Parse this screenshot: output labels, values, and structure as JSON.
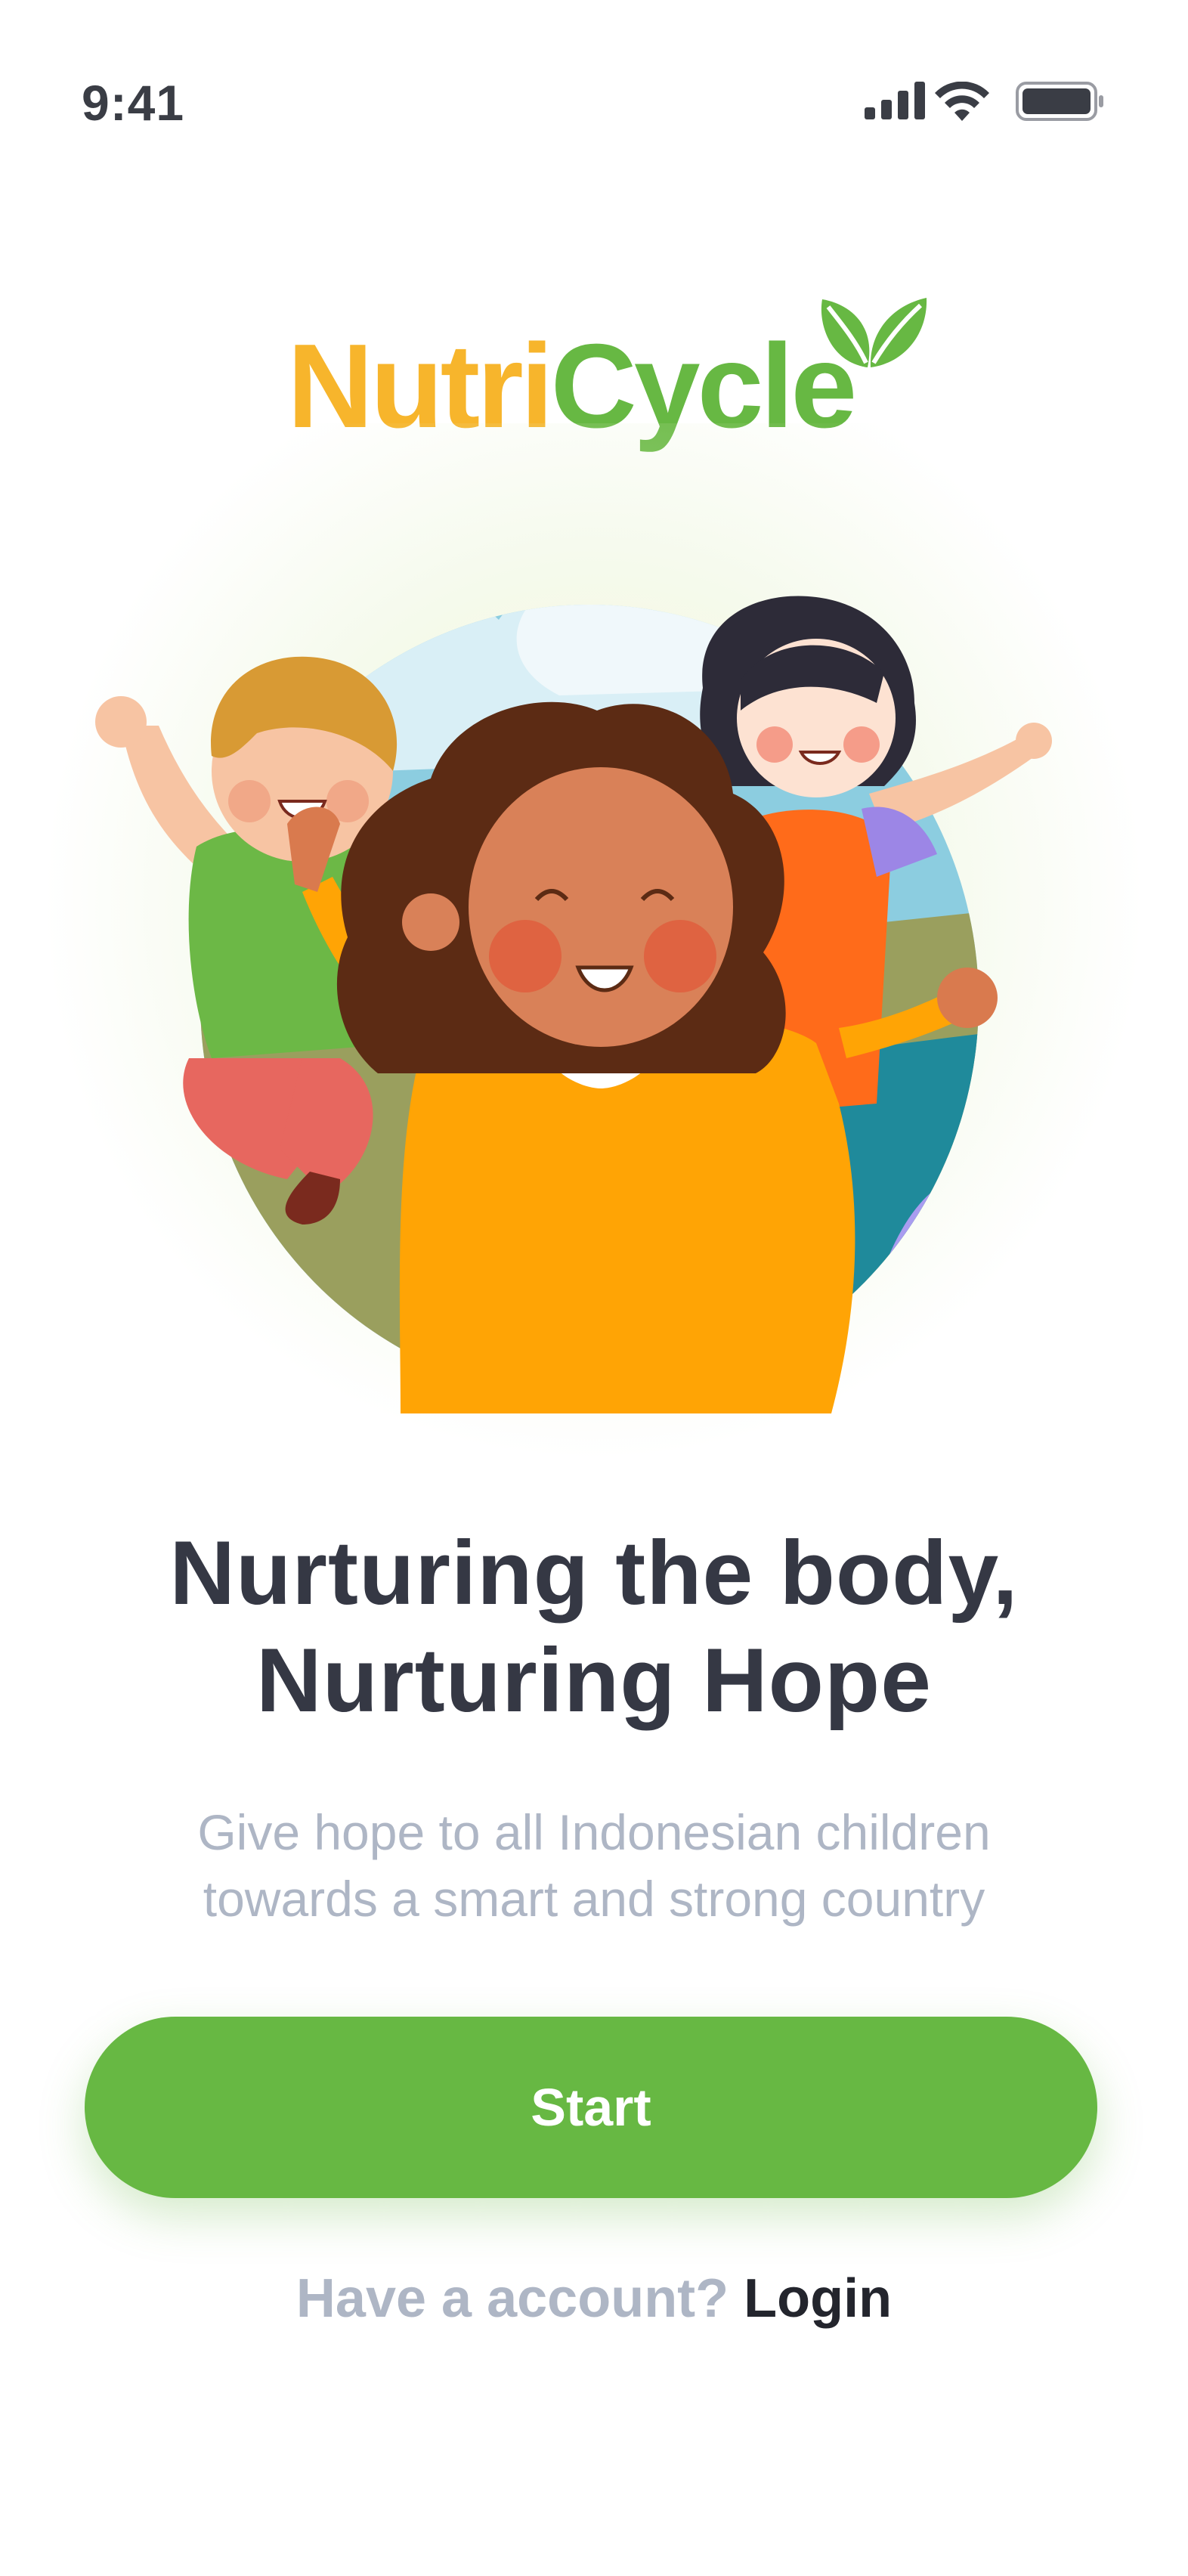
{
  "status_bar": {
    "time": "9:41",
    "icons": [
      "cellular-signal-icon",
      "wifi-icon",
      "battery-icon"
    ]
  },
  "logo": {
    "part1": "Nutri",
    "part2": "Cycle",
    "icon": "leaf-icon"
  },
  "hero": {
    "illustration": "happy-children-illustration"
  },
  "headline": {
    "line1": "Nurturing the body,",
    "line2": "Nurturing Hope"
  },
  "subtitle": {
    "line1": "Give hope to all Indonesian children",
    "line2": "towards a smart and strong country"
  },
  "start_button": {
    "label": "Start"
  },
  "login": {
    "prompt": "Have a account?",
    "link": "Login"
  },
  "colors": {
    "primary_green": "#67B843",
    "logo_orange": "#F7B52C",
    "heading": "#353844",
    "muted": "#AEB6C5"
  }
}
